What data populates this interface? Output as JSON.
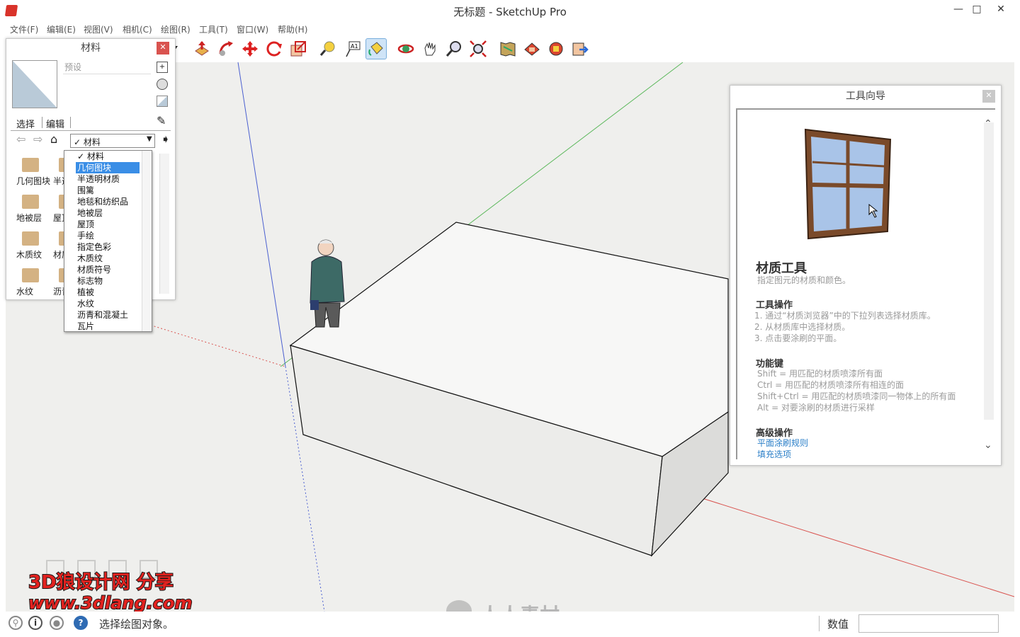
{
  "window": {
    "title": "无标题 - SketchUp Pro",
    "minimize": "—",
    "maximize": "□",
    "close": "✕"
  },
  "menu": [
    "文件(F)",
    "编辑(E)",
    "视图(V)",
    "相机(C)",
    "绘图(R)",
    "工具(T)",
    "窗口(W)",
    "帮助(H)"
  ],
  "toolbar": {
    "icons": [
      "dropdown-arrow-icon",
      "push-pull-icon",
      "follow-me-icon",
      "move-icon",
      "rotate-icon",
      "scale-icon",
      "tape-measure-icon",
      "text-icon",
      "paint-bucket-icon",
      "orbit-icon",
      "pan-icon",
      "zoom-icon",
      "zoom-extents-icon",
      "warehouse-icon",
      "extension-warehouse-icon",
      "components-icon",
      "share-icon"
    ],
    "active": "paint-bucket-icon"
  },
  "materials": {
    "title": "材料",
    "name_placeholder": "预设",
    "tabs": [
      "选择",
      "编辑"
    ],
    "combo_value": "✓ 材料",
    "grid": [
      "几何图块",
      "半透",
      "地被层",
      "屋顶",
      "木质纹",
      "材质",
      "水纹",
      "沥青"
    ],
    "dropdown": [
      "✓ 材料",
      "几何图块",
      "半透明材质",
      "围篱",
      "地毯和纺织品",
      "地被层",
      "屋顶",
      "手绘",
      "指定色彩",
      "木质纹",
      "材质符号",
      "标志物",
      "植被",
      "水纹",
      "沥青和混凝土",
      "瓦片"
    ],
    "dropdown_selected": 1
  },
  "instructor": {
    "title": "工具向导",
    "tool_name": "材质工具",
    "tool_desc": "指定图元的材质和颜色。",
    "ops_heading": "工具操作",
    "ops": [
      "1.   通过“材质浏览器”中的下拉列表选择材质库。",
      "2.   从材质库中选择材质。",
      "3.   点击要涂刷的平面。"
    ],
    "keys_heading": "功能键",
    "keys": [
      "Shift = 用匹配的材质喷漆所有面",
      "Ctrl = 用匹配的材质喷漆所有相连的面",
      "Shift+Ctrl = 用匹配的材质喷漆同一物体上的所有面",
      "Alt = 对要涂刷的材质进行采样"
    ],
    "adv_heading": "高级操作",
    "links": [
      "平面涂刷规则",
      "填充选项"
    ]
  },
  "status": {
    "text": "选择绘图对象。",
    "measure_label": "数值",
    "icons": [
      "geo-location-icon",
      "info-icon",
      "user-icon",
      "help-icon"
    ]
  },
  "watermarks": {
    "line1": "3D狼设计网 分享",
    "line2": "www.3dlang.com",
    "center": "人人素材"
  },
  "colors": {
    "viewport_bg": "#efefed",
    "red_axis": "#d9534f",
    "green_axis": "#5cb85c",
    "blue_axis": "#4a5fd0",
    "highlight": "#3a8ee6",
    "link": "#2b7fc8"
  }
}
